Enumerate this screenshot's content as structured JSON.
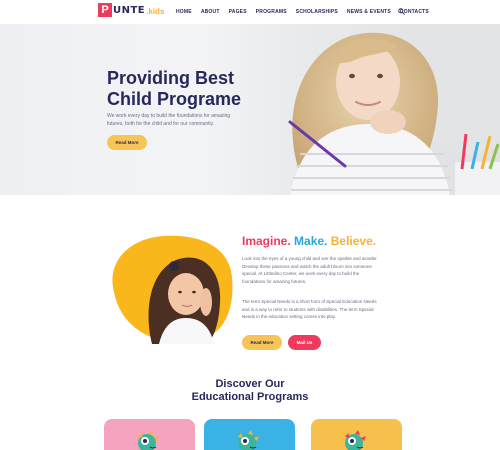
{
  "header": {
    "logo": {
      "initial": "P",
      "rest": "UNTE",
      "suffix": ".kids"
    },
    "nav": [
      "HOME",
      "ABOUT",
      "PAGES",
      "PROGRAMS",
      "SCHOLARSHIPS",
      "NEWS & EVENTS",
      "CONTACTS"
    ],
    "search_icon": "search-icon"
  },
  "hero": {
    "title_line1": "Providing Best",
    "title_line2": "Child Programe",
    "text_line1": "We work every day to build the foundations for amazing",
    "text_line2": "futures, both for the child and for our community.",
    "button": "Read More"
  },
  "imagine": {
    "word1": "Imagine.",
    "word2": "Make.",
    "word3": "Believe.",
    "para1": [
      "Look into the eyes of a young child and see the sparkle and wonder.",
      "Develop these passions and watch the adult bloom into someone",
      "special. At Littledino Center, we work every day to build the",
      "foundations for amazing futures."
    ],
    "para2": [
      "The term Special Needs is a short form of Special Education Needs",
      "and is a way to refer to students with disabilities. The term Special",
      "Needs in the education setting comes into play."
    ],
    "btn_read": "Read More",
    "btn_mail": "Mail Us"
  },
  "programs": {
    "title_line1": "Discover Our",
    "title_line2": "Educational Programs",
    "cards": [
      {
        "color": "#f5a3bf",
        "icon": "chameleon-icon"
      },
      {
        "color": "#3ab2e6",
        "icon": "chameleon-icon"
      },
      {
        "color": "#f8c04d",
        "icon": "chameleon-icon"
      }
    ]
  },
  "colors": {
    "navy": "#27285c",
    "pink": "#ef3a5d",
    "blue": "#2aa6dd",
    "yellow": "#f6b333"
  }
}
